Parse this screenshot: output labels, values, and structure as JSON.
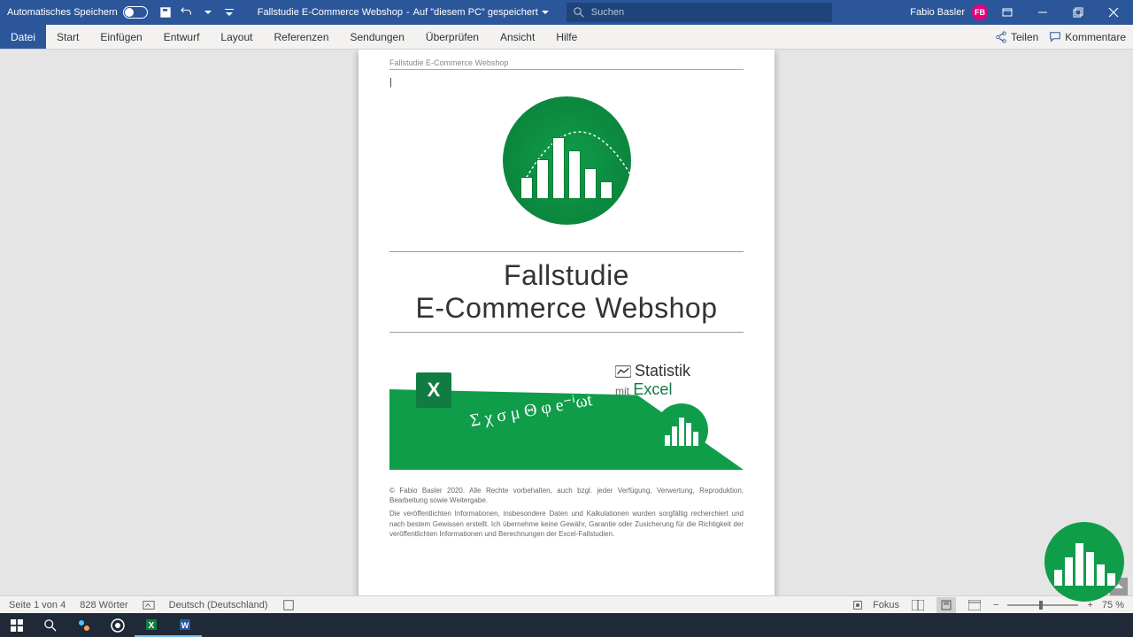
{
  "titlebar": {
    "autosave_label": "Automatisches Speichern",
    "doc_name": "Fallstudie E-Commerce Webshop",
    "doc_location": "Auf \"diesem PC\" gespeichert",
    "search_placeholder": "Suchen",
    "user_name": "Fabio Basler",
    "user_initials": "FB"
  },
  "ribbon": {
    "tabs": [
      "Datei",
      "Start",
      "Einfügen",
      "Entwurf",
      "Layout",
      "Referenzen",
      "Sendungen",
      "Überprüfen",
      "Ansicht",
      "Hilfe"
    ],
    "share": "Teilen",
    "comments": "Kommentare"
  },
  "document": {
    "header_text": "Fallstudie E-Commerce Webshop",
    "title_line1": "Fallstudie",
    "title_line2": "E-Commerce Webshop",
    "banner": {
      "excel_x": "X",
      "greek_symbols": "Σ χ σ μ Θ φ e⁻ⁱωt",
      "statistik": "Statistik",
      "mit": "mit",
      "excel": "Excel"
    },
    "copyright_p1": "© Fabio Basler 2020. Alle Rechte vorbehalten, auch bzgl. jeder Verfügung, Verwertung, Reproduktion, Bearbeitung sowie Weitergabe.",
    "copyright_p2": "Die veröffentlichten Informationen, insbesondere Daten und Kalkulationen wurden sorgfältig recherchiert und nach bestem Gewissen erstellt. Ich übernehme keine Gewähr, Garantie oder Zusicherung für die Richtigkeit der veröffentlichten Informationen und Berechnungen der Excel-Fallstudien."
  },
  "statusbar": {
    "page_info": "Seite 1 von 4",
    "word_count": "828 Wörter",
    "language": "Deutsch (Deutschland)",
    "focus": "Fokus",
    "zoom": "75 %"
  }
}
